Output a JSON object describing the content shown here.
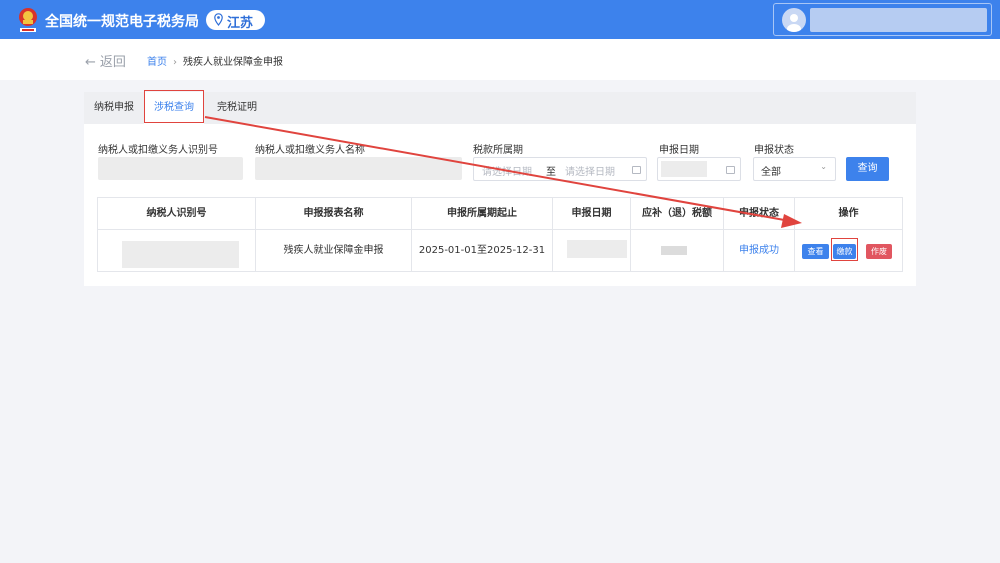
{
  "header": {
    "app_title": "全国统一规范电子税务局",
    "region": "江苏"
  },
  "breadcrumb": {
    "back": "返回",
    "home": "首页",
    "separator": "›",
    "current": "残疾人就业保障金申报"
  },
  "tabs": [
    {
      "label": "纳税申报",
      "active": false
    },
    {
      "label": "涉税查询",
      "active": true
    },
    {
      "label": "完税证明",
      "active": false
    }
  ],
  "filters": {
    "taxpayer_id_label": "纳税人或扣缴义务人识别号",
    "taxpayer_name_label": "纳税人或扣缴义务人名称",
    "period_label": "税款所属期",
    "period_start_placeholder": "请选择日期",
    "period_to": "至",
    "period_end_placeholder": "请选择日期",
    "declare_date_label": "申报日期",
    "status_label": "申报状态",
    "status_value": "全部",
    "query_button": "查询"
  },
  "table": {
    "headers": [
      "纳税人识别号",
      "申报报表名称",
      "申报所属期起止",
      "申报日期",
      "应补（退）税额",
      "申报状态",
      "操作"
    ],
    "rows": [
      {
        "report_name": "残疾人就业保障金申报",
        "period": "2025-01-01至2025-12-31",
        "status": "申报成功",
        "actions": {
          "view": "查看",
          "pay": "缴款",
          "void": "作废"
        }
      }
    ]
  },
  "colors": {
    "brand": "#3d82ec",
    "danger": "#e15660",
    "annotation": "#e0443e"
  }
}
